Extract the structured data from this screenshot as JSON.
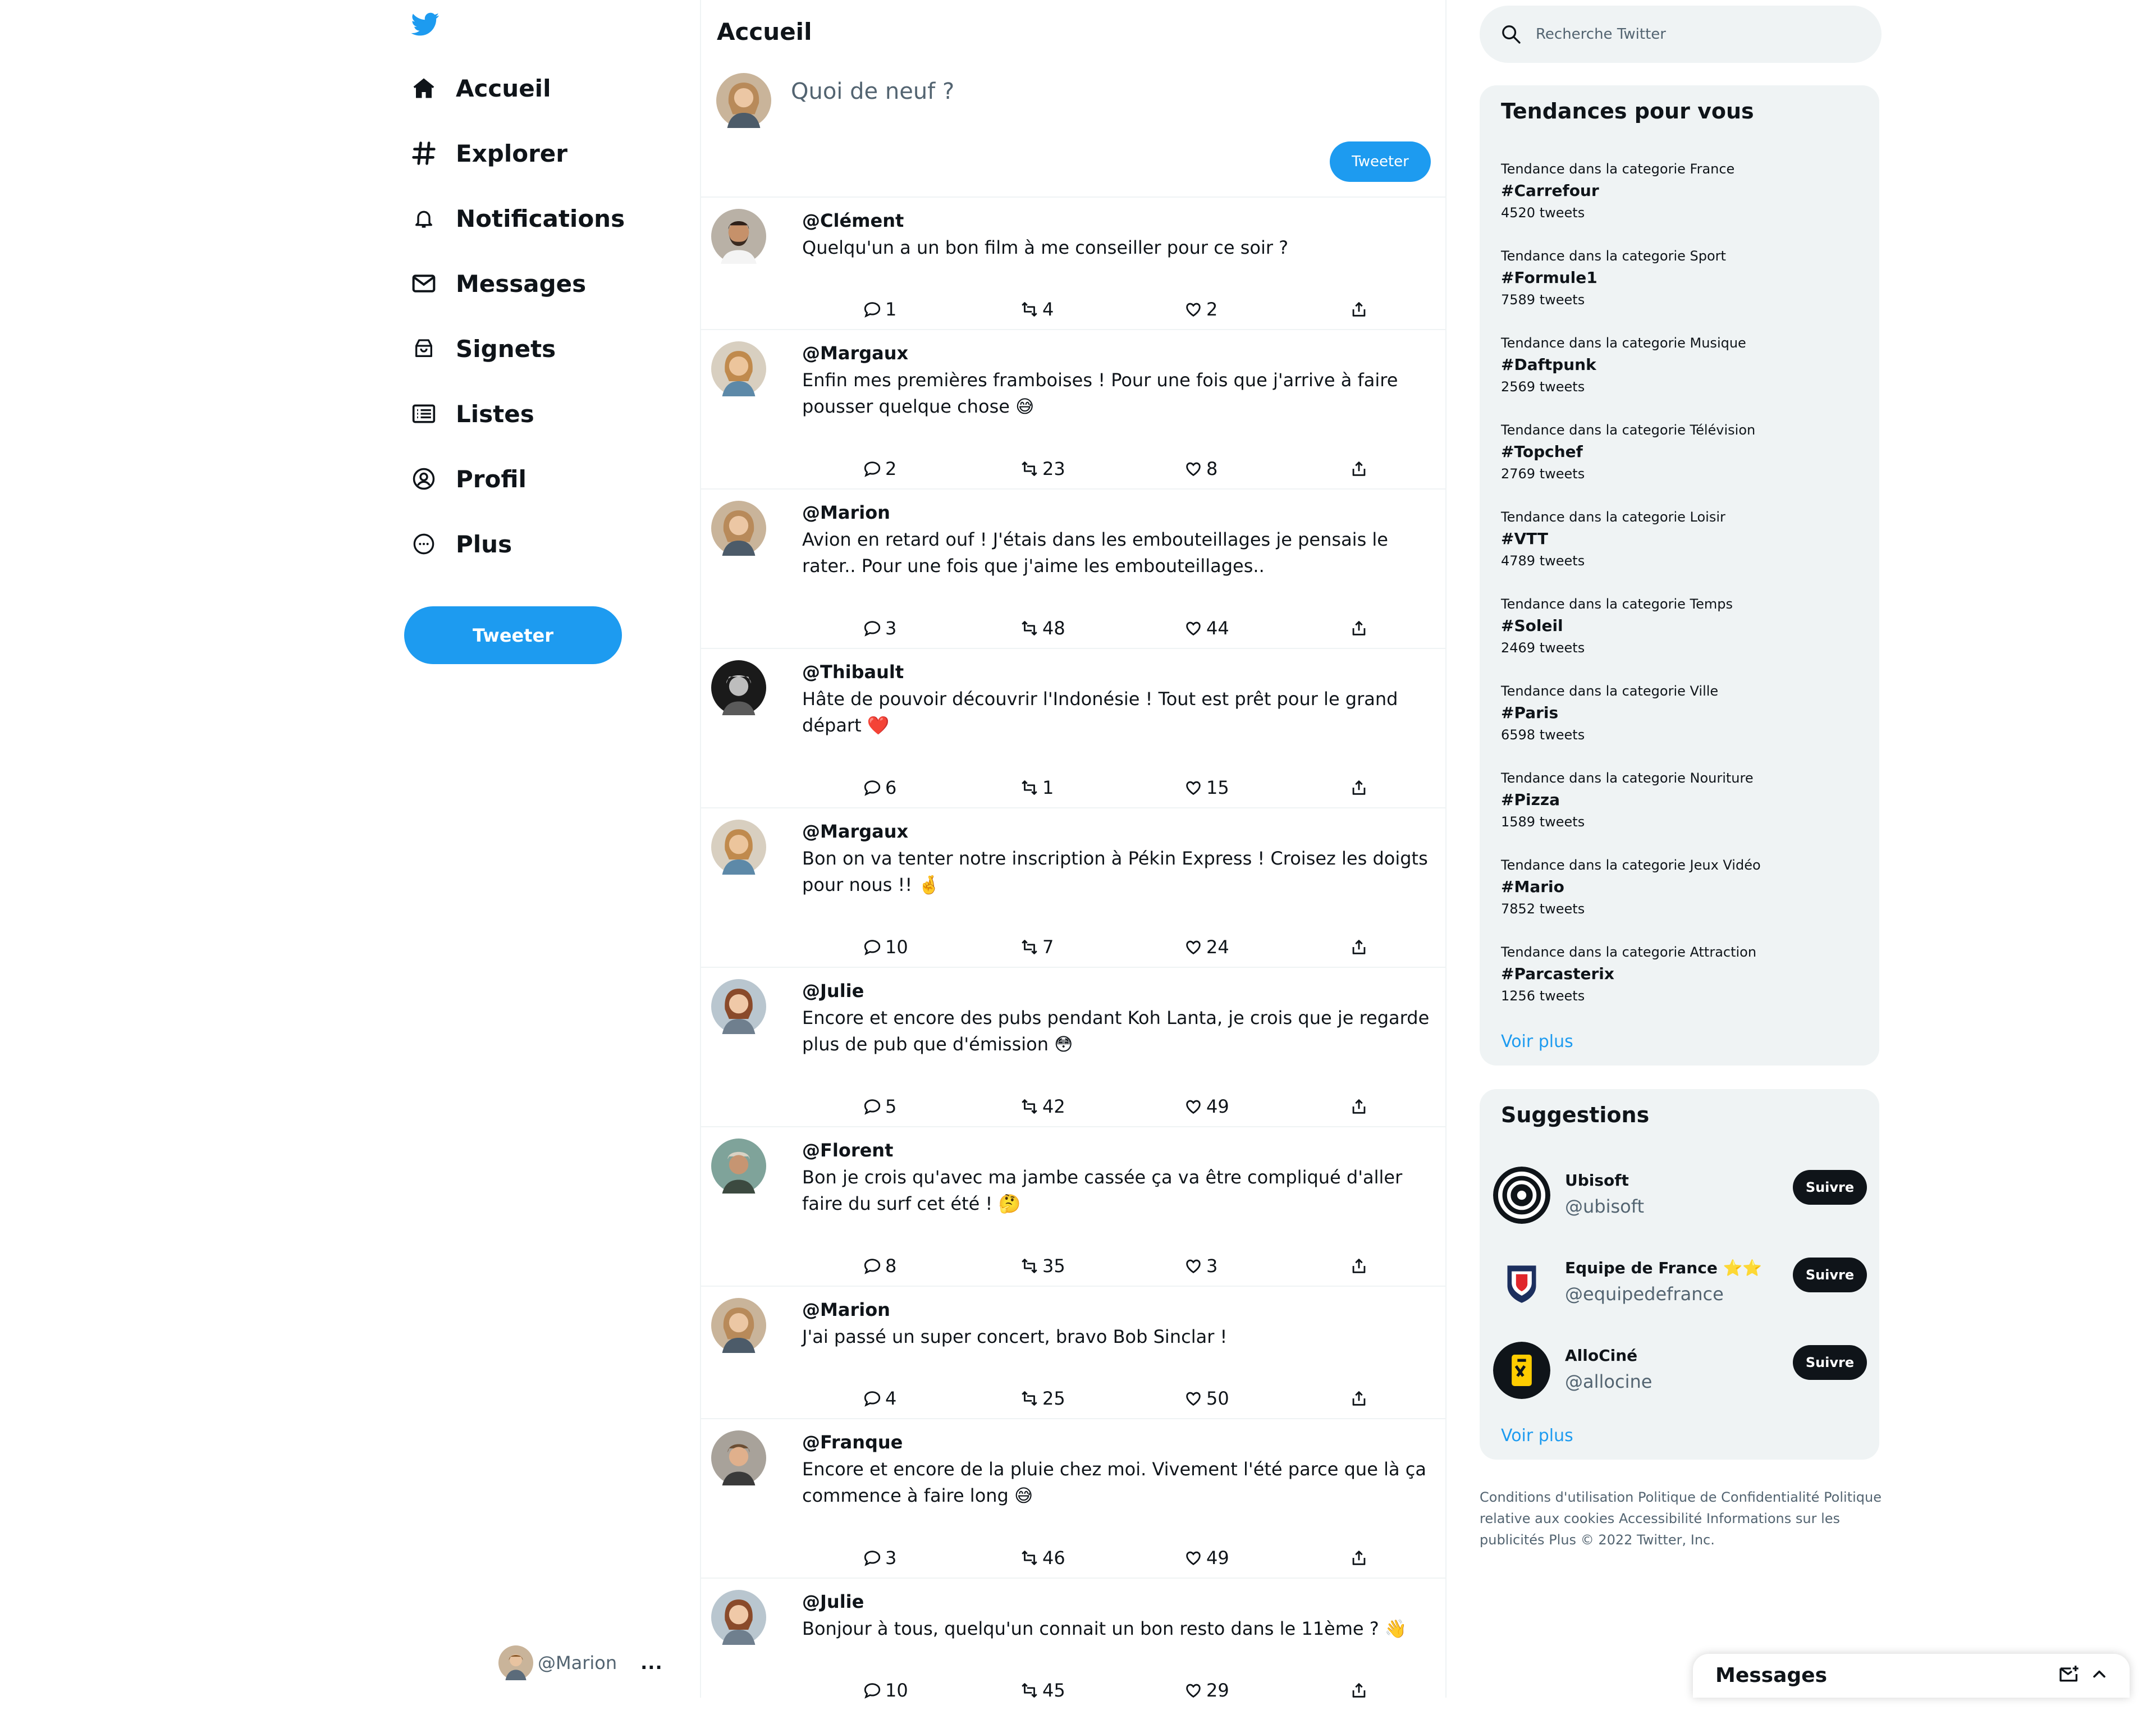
{
  "nav": {
    "items": [
      {
        "label": "Accueil",
        "icon": "home-icon"
      },
      {
        "label": "Explorer",
        "icon": "hashtag-icon"
      },
      {
        "label": "Notifications",
        "icon": "bell-icon"
      },
      {
        "label": "Messages",
        "icon": "envelope-icon"
      },
      {
        "label": "Signets",
        "icon": "bookmark-icon"
      },
      {
        "label": "Listes",
        "icon": "list-icon"
      },
      {
        "label": "Profil",
        "icon": "user-icon"
      },
      {
        "label": "Plus",
        "icon": "more-icon"
      }
    ],
    "tweet_button": "Tweeter",
    "account_handle": "@Marion",
    "account_more": "..."
  },
  "feed": {
    "title": "Accueil",
    "composer_placeholder": "Quoi de neuf ?",
    "tweet_button": "Tweeter",
    "tweets": [
      {
        "user": "@Clément",
        "text": "Quelqu'un a un bon film à me conseiller pour ce soir ?",
        "replies": "1",
        "retweets": "4",
        "likes": "2"
      },
      {
        "user": "@Margaux",
        "text": "Enfin mes premières framboises ! Pour une fois que j'arrive à faire pousser quelque chose 😅",
        "replies": "2",
        "retweets": "23",
        "likes": "8"
      },
      {
        "user": "@Marion",
        "text": "Avion en retard ouf ! J'étais dans les embouteillages je pensais le rater.. Pour une fois que j'aime les embouteillages..",
        "replies": "3",
        "retweets": "48",
        "likes": "44"
      },
      {
        "user": "@Thibault",
        "text": "Hâte de pouvoir découvrir l'Indonésie ! Tout est prêt pour le grand départ ❤️",
        "replies": "6",
        "retweets": "1",
        "likes": "15"
      },
      {
        "user": "@Margaux",
        "text": "Bon on va tenter notre inscription à Pékin Express ! Croisez les doigts pour nous !! 🤞",
        "replies": "10",
        "retweets": "7",
        "likes": "24"
      },
      {
        "user": "@Julie",
        "text": "Encore et encore des pubs pendant Koh Lanta, je crois que je regarde plus de pub que d'émission 😳",
        "replies": "5",
        "retweets": "42",
        "likes": "49"
      },
      {
        "user": "@Florent",
        "text": "Bon je crois qu'avec ma jambe cassée ça va être compliqué d'aller faire du surf cet été ! 🤔",
        "replies": "8",
        "retweets": "35",
        "likes": "3"
      },
      {
        "user": "@Marion",
        "text": "J'ai passé un super concert, bravo Bob Sinclar !",
        "replies": "4",
        "retweets": "25",
        "likes": "50"
      },
      {
        "user": "@Franque",
        "text": "Encore et encore de la pluie chez moi. Vivement l'été parce que là ça commence à faire long 😅",
        "replies": "3",
        "retweets": "46",
        "likes": "49"
      },
      {
        "user": "@Julie",
        "text": "Bonjour à tous, quelqu'un connait un bon resto dans le 11ème ? 👋",
        "replies": "10",
        "retweets": "45",
        "likes": "29"
      }
    ]
  },
  "search": {
    "placeholder": "Recherche Twitter"
  },
  "trends": {
    "title": "Tendances pour vous",
    "items": [
      {
        "category": "Tendance dans la categorie France",
        "tag": "#Carrefour",
        "count": "4520 tweets"
      },
      {
        "category": "Tendance dans la categorie Sport",
        "tag": "#Formule1",
        "count": "7589 tweets"
      },
      {
        "category": "Tendance dans la categorie Musique",
        "tag": "#Daftpunk",
        "count": "2569 tweets"
      },
      {
        "category": "Tendance dans la categorie Télévision",
        "tag": "#Topchef",
        "count": "2769 tweets"
      },
      {
        "category": "Tendance dans la categorie Loisir",
        "tag": "#VTT",
        "count": "4789 tweets"
      },
      {
        "category": "Tendance dans la categorie Temps",
        "tag": "#Soleil",
        "count": "2469 tweets"
      },
      {
        "category": "Tendance dans la categorie Ville",
        "tag": "#Paris",
        "count": "6598 tweets"
      },
      {
        "category": "Tendance dans la categorie Nouriture",
        "tag": "#Pizza",
        "count": "1589 tweets"
      },
      {
        "category": "Tendance dans la categorie Jeux Vidéo",
        "tag": "#Mario",
        "count": "7852 tweets"
      },
      {
        "category": "Tendance dans la categorie Attraction",
        "tag": "#Parcasterix",
        "count": "1256 tweets"
      }
    ],
    "see_more": "Voir plus"
  },
  "suggestions": {
    "title": "Suggestions",
    "items": [
      {
        "name": "Ubisoft",
        "handle": "@ubisoft",
        "button": "Suivre"
      },
      {
        "name": "Equipe de France ⭐⭐",
        "handle": "@equipedefrance",
        "button": "Suivre"
      },
      {
        "name": "AlloCiné",
        "handle": "@allocine",
        "button": "Suivre"
      }
    ],
    "see_more": "Voir plus"
  },
  "footer": {
    "links": [
      "Conditions d'utilisation",
      "Politique de Confidentialité",
      "Politique relative aux cookies",
      "Accessibilité",
      "Informations sur les publicités",
      "Plus"
    ],
    "copyright": "© 2022 Twitter, Inc."
  },
  "messages_bar": {
    "title": "Messages"
  },
  "colors": {
    "accent": "#1d9bf0",
    "text": "#0f1419",
    "muted": "#536471",
    "panel": "#eff3f4"
  }
}
